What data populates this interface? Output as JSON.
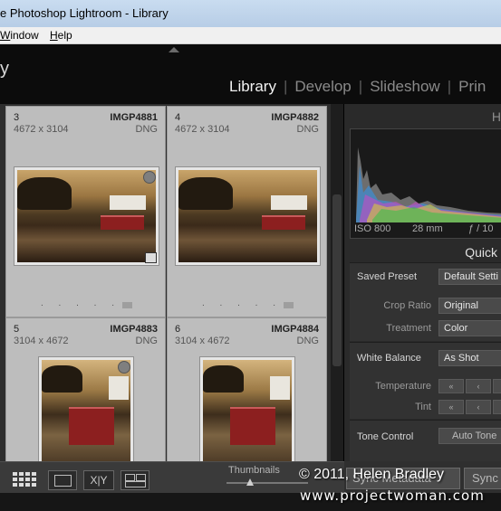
{
  "window": {
    "title": "e Photoshop Lightroom - Library"
  },
  "menu": {
    "items": [
      {
        "label": "Window",
        "underline": "W"
      },
      {
        "label": "Help",
        "underline": "H"
      }
    ]
  },
  "module_picker": {
    "identity_text": "y",
    "modules": [
      "Library",
      "Develop",
      "Slideshow",
      "Prin"
    ],
    "active": "Library"
  },
  "grid": {
    "cells": [
      {
        "index": "3",
        "dims": "4672 x 3104",
        "name": "IMGP4881",
        "type": "DNG"
      },
      {
        "index": "4",
        "dims": "4672 x 3104",
        "name": "IMGP4882",
        "type": "DNG"
      },
      {
        "index": "5",
        "dims": "3104 x 4672",
        "name": "IMGP4883",
        "type": "DNG"
      },
      {
        "index": "6",
        "dims": "3104 x 4672",
        "name": "IMGP4884",
        "type": "DNG"
      }
    ],
    "rating_dots": ". . . . ."
  },
  "histogram": {
    "header": "Hist",
    "iso": "ISO 800",
    "focal": "28 mm",
    "aperture": "ƒ / 10"
  },
  "quick_develop": {
    "header": "Quick D",
    "saved_preset": {
      "label": "Saved Preset",
      "value": "Default Setti"
    },
    "crop_ratio": {
      "label": "Crop Ratio",
      "value": "Original"
    },
    "treatment": {
      "label": "Treatment",
      "value": "Color"
    },
    "white_balance": {
      "label": "White Balance",
      "value": "As Shot"
    },
    "temperature": {
      "label": "Temperature"
    },
    "tint": {
      "label": "Tint"
    },
    "tone_control": {
      "label": "Tone Control",
      "value": "Auto Tone"
    },
    "stepper_glyphs": {
      "double_left": "«",
      "single_left": "‹"
    }
  },
  "toolbar": {
    "thumbnails_label": "Thumbnails",
    "xy_label": "X|Y"
  },
  "sync": {
    "sync_metadata": "Sync Metadata",
    "sync": "Sync"
  },
  "watermark": {
    "line1": "© 2011, Helen Bradley",
    "line2": "www.projectwoman.com"
  },
  "colors": {
    "panel_bg": "#2a2a2a",
    "grid_cell": "#bdbdbd",
    "active_module": "#f2f2f2",
    "inactive_module": "#8a8a8a"
  }
}
